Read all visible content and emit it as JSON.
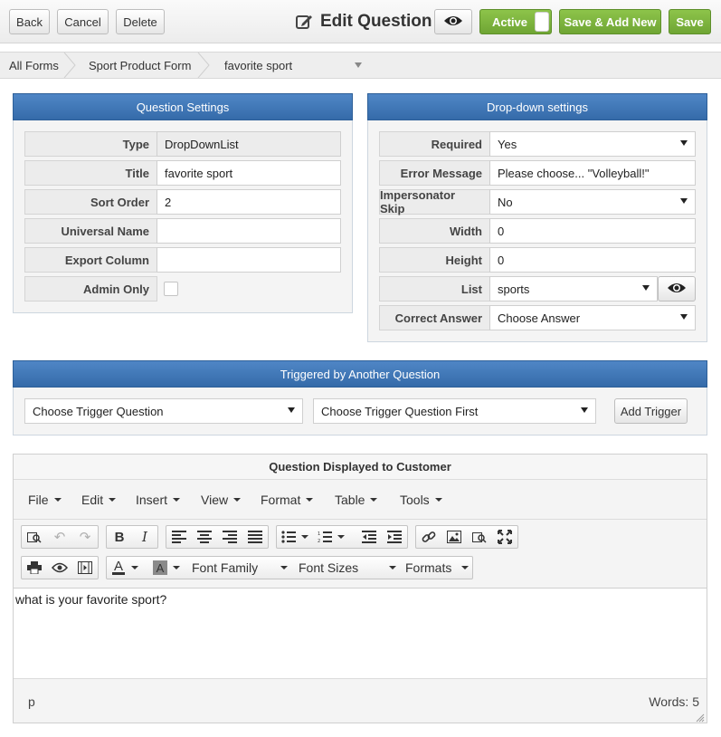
{
  "header": {
    "back_label": "Back",
    "cancel_label": "Cancel",
    "delete_label": "Delete",
    "title": "Edit Question",
    "active_label": "Active",
    "save_add_new_label": "Save & Add New",
    "save_label": "Save"
  },
  "breadcrumb": {
    "items": [
      "All Forms",
      "Sport Product Form",
      "favorite sport"
    ]
  },
  "question_settings": {
    "heading": "Question Settings",
    "rows": [
      {
        "label": "Type",
        "value": "DropDownList"
      },
      {
        "label": "Title",
        "value": "favorite sport"
      },
      {
        "label": "Sort Order",
        "value": "2"
      },
      {
        "label": "Universal Name",
        "value": ""
      },
      {
        "label": "Export Column",
        "value": ""
      },
      {
        "label": "Admin Only",
        "value": ""
      }
    ]
  },
  "dropdown_settings": {
    "heading": "Drop-down settings",
    "rows": [
      {
        "label": "Required",
        "value": "Yes"
      },
      {
        "label": "Error Message",
        "value": "Please choose... \"Volleyball!\""
      },
      {
        "label": "Impersonator Skip",
        "value": "No"
      },
      {
        "label": "Width",
        "value": "0"
      },
      {
        "label": "Height",
        "value": "0"
      },
      {
        "label": "List",
        "value": "sports"
      },
      {
        "label": "Correct Answer",
        "value": "Choose Answer"
      }
    ]
  },
  "trigger": {
    "heading": "Triggered by Another Question",
    "question_select": "Choose Trigger Question",
    "answer_select": "Choose Trigger Question First",
    "add_label": "Add Trigger"
  },
  "editor": {
    "heading": "Question Displayed to Customer",
    "menus": [
      "File",
      "Edit",
      "Insert",
      "View",
      "Format",
      "Table",
      "Tools"
    ],
    "font_family_label": "Font Family",
    "font_sizes_label": "Font Sizes",
    "formats_label": "Formats",
    "content": "what is your favorite sport?",
    "path": "p",
    "word_count": "Words: 5"
  },
  "colors": {
    "panel_header": "#4f86c6",
    "green_button": "#7cb53d",
    "toolbar_bg": "#f4f4f4"
  }
}
